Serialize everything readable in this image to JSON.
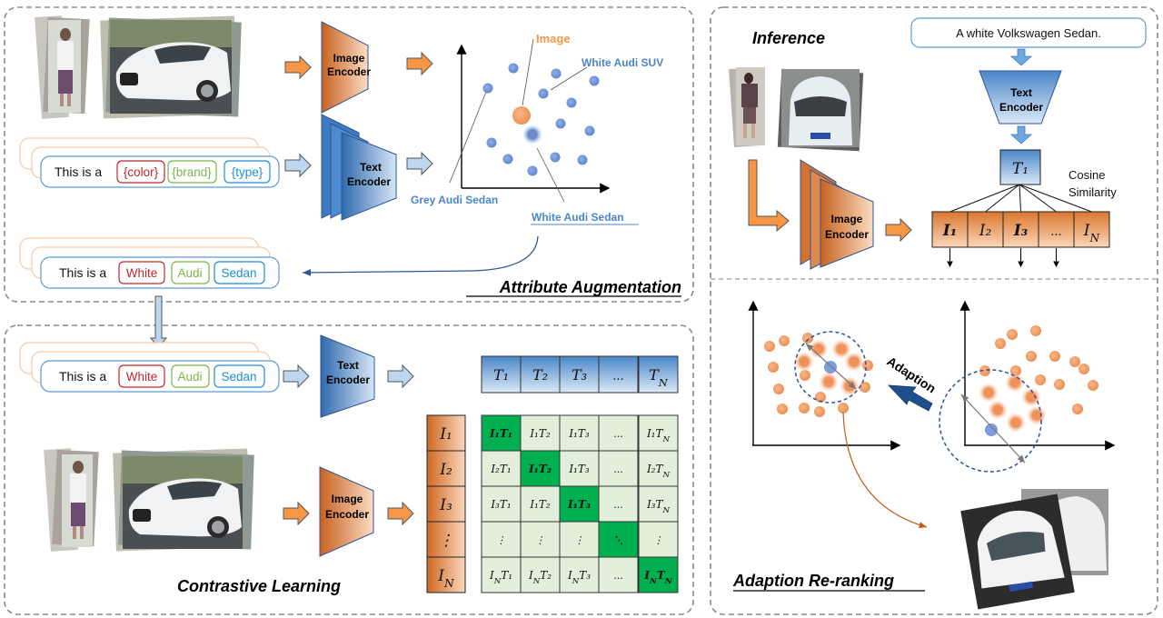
{
  "panels": {
    "attribute_augmentation": {
      "title": "Attribute Augmentation",
      "image_encoder_label": [
        "Image",
        "Encoder"
      ],
      "text_encoder_label": [
        "Text",
        "Encoder"
      ],
      "template_prompt": {
        "prefix": "This is a",
        "tokens": [
          {
            "text": "{color}",
            "color": "#c0282f"
          },
          {
            "text": "{brand}",
            "color": "#7ab648"
          },
          {
            "text": "{type}",
            "color": "#1b8fd6"
          }
        ]
      },
      "augmented_prompt": {
        "prefix": "This is a",
        "tokens": [
          {
            "text": "White",
            "color": "#c0282f"
          },
          {
            "text": "Audi",
            "color": "#7ab648"
          },
          {
            "text": "Sedan",
            "color": "#1b8fd6"
          }
        ]
      },
      "embedding_plot": {
        "labels": {
          "image": "Image",
          "white_audi_suv": "White Audi SUV",
          "grey_audi_sedan": "Grey Audi Sedan",
          "white_audi_sedan": "White Audi Sedan"
        }
      }
    },
    "contrastive_learning": {
      "title": "Contrastive Learning",
      "prompt": {
        "prefix": "This is a",
        "tokens": [
          {
            "text": "White",
            "color": "#c0282f"
          },
          {
            "text": "Audi",
            "color": "#7ab648"
          },
          {
            "text": "Sedan",
            "color": "#1b8fd6"
          }
        ]
      },
      "text_encoder_label": [
        "Text",
        "Encoder"
      ],
      "image_encoder_label": [
        "Image",
        "Encoder"
      ],
      "text_features": [
        "T₁",
        "T₂",
        "T₃",
        "...",
        "T_N"
      ],
      "image_features": [
        "I₁",
        "I₂",
        "I₃",
        "⋮",
        "I_N"
      ],
      "similarity_matrix": [
        [
          "I₁T₁",
          "I₁T₂",
          "I₁T₃",
          "...",
          "I₁T_N"
        ],
        [
          "I₂T₁",
          "I₁T₂",
          "I₁T₃",
          "...",
          "I₂T_N"
        ],
        [
          "I₃T₁",
          "I₁T₂",
          "I₁T₃",
          "...",
          "I₃T_N"
        ],
        [
          "⋮",
          "⋮",
          "⋮",
          "⋱",
          "⋮"
        ],
        [
          "I_NT₁",
          "I_NT₂",
          "I_NT₃",
          "...",
          "I_NT_N"
        ]
      ]
    },
    "inference": {
      "title": "Inference",
      "query_text": "A white Volkswagen Sedan.",
      "text_encoder_label": [
        "Text",
        "Encoder"
      ],
      "image_encoder_label": [
        "Image",
        "Encoder"
      ],
      "text_feature": "T₁",
      "similarity_label": [
        "Cosine",
        "Similarity"
      ],
      "gallery_features": [
        "I₁",
        "I₂",
        "I₃",
        "...",
        "I_N"
      ]
    },
    "adaption_reranking": {
      "title": "Adaption Re-ranking",
      "arrow_label": "Adaption"
    }
  },
  "colors": {
    "orange": "#e57f3b",
    "orange_light": "#fbd3b4",
    "blue": "#3d78c0",
    "blue_light": "#c5dcf1",
    "green": "#00b050",
    "green_light": "#e2efda",
    "label_blue": "#4a86c8",
    "dark_navy": "#1f4e8c"
  }
}
